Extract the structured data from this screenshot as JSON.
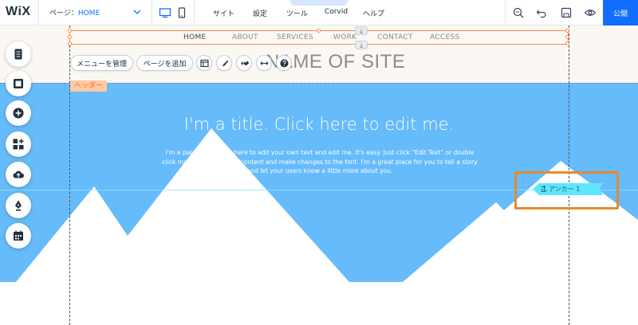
{
  "app": {
    "logo": "WiX",
    "publish_label": "公開"
  },
  "page_selector": {
    "prefix": "ページ：",
    "value": "HOME"
  },
  "top_menu": [
    "サイト",
    "設定",
    "ツール",
    "Corvid",
    "ヘルプ"
  ],
  "tab_handle_glyph": "⌃",
  "site_nav": [
    "HOME",
    "ABOUT",
    "SERVICES",
    "WORK",
    "CONTACT",
    "ACCESS"
  ],
  "site_name": "NAME OF SITE",
  "header_toolbar": {
    "manage_menu": "メニューを管理",
    "add_page": "ページを追加"
  },
  "header_tag": "ヘッダー",
  "hero": {
    "title": "I'm a title. Click here to edit me.",
    "paragraph": "I'm a paragraph. Click here to add your own text and edit me. It's easy. Just click \"Edit Text\" or double click me to add your own content and make changes to the font. I'm a great place for you to tell a story and let your users know a little more about you."
  },
  "anchor": {
    "label": "アンカー 1"
  },
  "colors": {
    "accent": "#116dff",
    "hero_bg": "#66bbfb",
    "selection": "#ff8a4c",
    "highlight": "#e68a2e",
    "anchor": "#5ee6ff"
  },
  "icons": {
    "left_toolbar": [
      "menus-pages-icon",
      "background-icon",
      "add-icon",
      "app-market-icon",
      "media-upload-icon",
      "blog-pen-icon",
      "bookings-icon"
    ]
  }
}
